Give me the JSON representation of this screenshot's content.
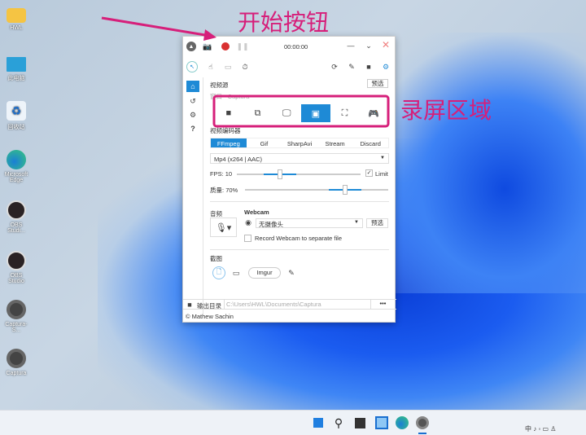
{
  "desktop_icons": [
    "HWL",
    "此电脑",
    "回收站",
    "Microsoft Edge",
    "OBS Studi...",
    "OBS Studio",
    "Captura-S...",
    "Captura"
  ],
  "annotations": {
    "start_button": "开始按钮",
    "record_area": "录屏区域",
    "color": "#d61f7a"
  },
  "titlebar": {
    "timer": "00:00:00"
  },
  "sidebar": {
    "help": "?"
  },
  "video_source": {
    "label": "视频源",
    "preview": "预选",
    "current": "窗口 - Captura"
  },
  "encoder": {
    "label": "视频编码器",
    "tabs": [
      "FFmpeg",
      "Gif",
      "SharpAvi",
      "Stream",
      "Discard"
    ],
    "format": "Mp4 (x264 | AAC)",
    "fps_label": "FPS:",
    "fps_value": "10",
    "limit_label": "Limit",
    "quality_label": "质量:",
    "quality_value": "70%",
    "fps_fraction": 0.35,
    "quality_fraction": 0.7
  },
  "audio": {
    "label": "音频"
  },
  "webcam": {
    "label": "Webcam",
    "device": "无摄像头",
    "preview": "预选",
    "separate_label": "Record Webcam to separate file"
  },
  "screenshot": {
    "label": "截图",
    "imgur": "Imgur"
  },
  "output": {
    "label": "输出目录",
    "path": "C:\\Users\\HWL\\Documents\\Captura",
    "more": "•••"
  },
  "footer": {
    "copyright": "© Mathew Sachin"
  },
  "accent": "#1e8ad6"
}
